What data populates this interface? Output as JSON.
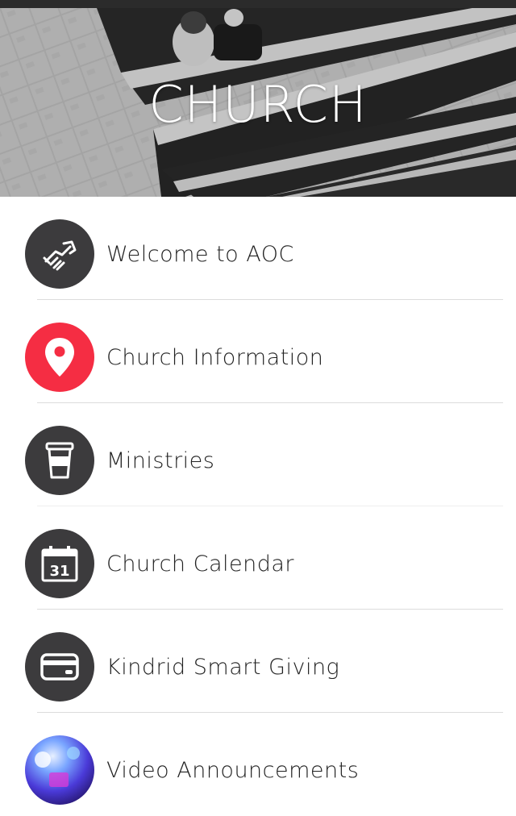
{
  "header": {
    "title": "CHURCH"
  },
  "menu": {
    "items": [
      {
        "label": "Welcome to AOC",
        "icon": "handshake-icon"
      },
      {
        "label": "Church Information",
        "icon": "map-pin-icon",
        "color": "#f52d43"
      },
      {
        "label": "Ministries",
        "icon": "cup-icon"
      },
      {
        "label": "Church Calendar",
        "icon": "calendar-icon",
        "day": "31"
      },
      {
        "label": "Kindrid Smart Giving",
        "icon": "credit-card-icon"
      },
      {
        "label": "Video Announcements",
        "icon": "video-thumbnail"
      }
    ]
  },
  "colors": {
    "icon_bg": "#3c3b3d",
    "accent": "#f52d43",
    "divider": "#dcdcdc"
  }
}
